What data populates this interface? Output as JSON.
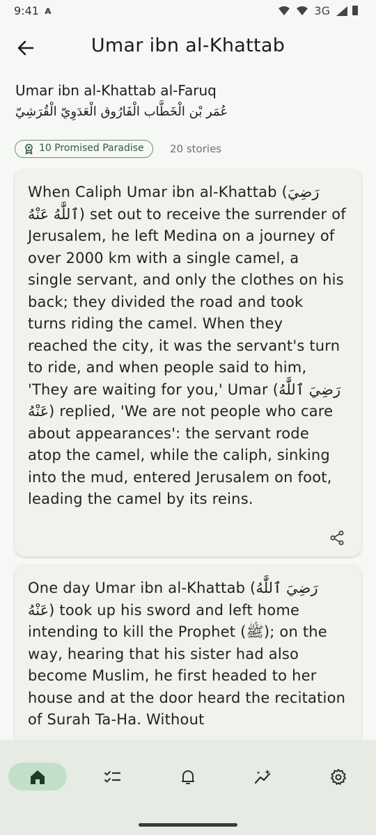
{
  "status_bar": {
    "time": "9:41",
    "network": "3G",
    "icons": [
      "wifi-off-icon",
      "wifi-off-icon",
      "signal-icon",
      "battery-icon"
    ]
  },
  "app_bar": {
    "title": "Umar ibn al-Khattab",
    "back_icon": "arrow-left-icon"
  },
  "companion": {
    "full_name": "Umar ibn al-Khattab al-Faruq",
    "arabic_name": "عُمَر بْن الْخَطَّاب الْفَارُوق الْعَدَوِيّ الْقُرَشِيّ",
    "badge_label": "10 Promised Paradise",
    "badge_icon": "award-ribbon-icon",
    "stories_count": "20 stories"
  },
  "stories": [
    {
      "text": "When Caliph Umar ibn al-Khattab (رَضِيَ ٱللَّٰهُ عَنْهُ) set out to receive the surrender of Jerusalem, he left Medina on a journey of over 2000 km with a single camel, a single servant, and only the clothes on his back; they divided the road and took turns riding the camel. When they reached the city, it was the servant's turn to ride, and when people said to him, 'They are waiting for you,' Umar (رَضِيَ ٱللَّٰهُ عَنْهُ) replied, 'We are not people who care about appearances': the servant rode atop the camel, while the caliph, sinking into the mud, entered Jerusalem on foot, leading the camel by its reins.",
      "share_icon": "share-icon"
    },
    {
      "text": "One day Umar ibn al-Khattab (رَضِيَ ٱللَّٰهُ عَنْهُ) took up his sword and left home intending to kill the Prophet (ﷺ); on the way, hearing that his sister had also become Muslim, he first headed to her house and at the door heard the recitation of Surah Ta-Ha. Without"
    }
  ],
  "bottom_nav": {
    "items": [
      {
        "icon": "home-icon",
        "active": true
      },
      {
        "icon": "checklist-icon",
        "active": false
      },
      {
        "icon": "bell-icon",
        "active": false
      },
      {
        "icon": "sparkle-chart-icon",
        "active": false
      },
      {
        "icon": "settings-gear-icon",
        "active": false
      }
    ]
  },
  "colors": {
    "background": "#f6f8f5",
    "card": "#f0f2ee",
    "accent": "#2f5a3e",
    "nav_active": "#c3dfc9",
    "nav_bar": "#e6ebe4"
  }
}
